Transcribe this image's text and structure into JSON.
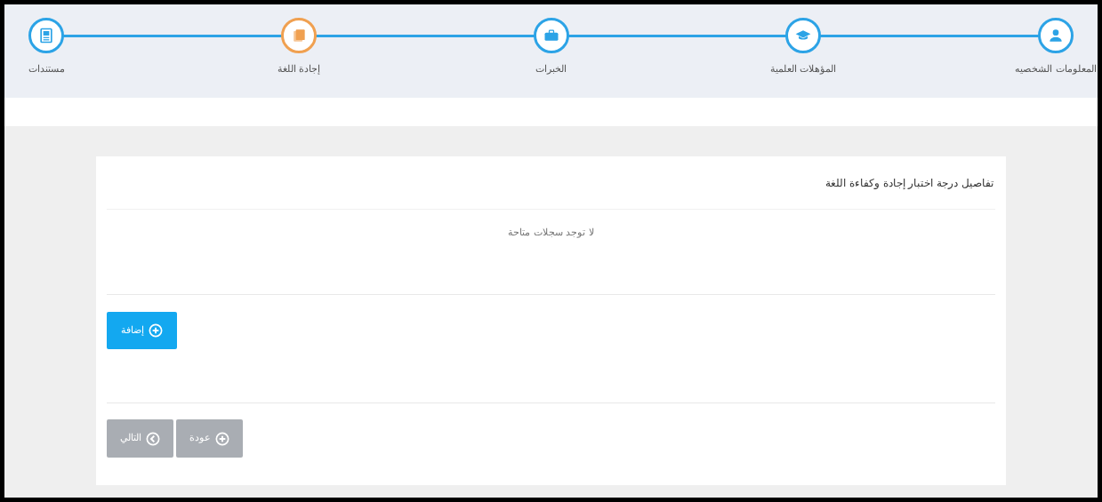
{
  "steps": [
    {
      "label": "المعلومات الشخصيه",
      "kind": "person",
      "selected": false
    },
    {
      "label": "المؤهلات العلمية",
      "kind": "graduation",
      "selected": false
    },
    {
      "label": "الخبرات",
      "kind": "briefcase",
      "selected": false
    },
    {
      "label": "إجادة اللغة",
      "kind": "papers",
      "selected": true
    },
    {
      "label": "مستندات",
      "kind": "document",
      "selected": false
    }
  ],
  "card": {
    "title": "تفاصيل درجة اختبار إجادة وكفاءة اللغة",
    "empty_message": "لا توجد سجلات متاحة"
  },
  "add_button": {
    "label": "إضافة",
    "disabled": false
  },
  "nav_buttons": [
    {
      "label": "عودة",
      "kind": "plus",
      "disabled": true
    },
    {
      "label": "التالي",
      "kind": "next",
      "disabled": true
    }
  ]
}
